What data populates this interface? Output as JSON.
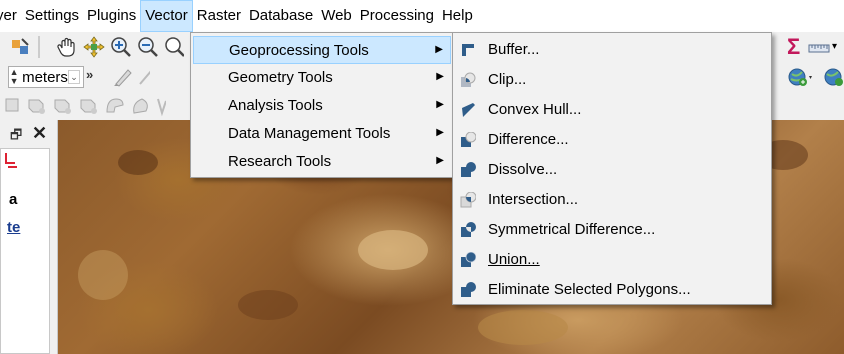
{
  "menubar": {
    "items": [
      {
        "label": "yer"
      },
      {
        "label": "Settings"
      },
      {
        "label": "Plugins"
      },
      {
        "label": "Vector",
        "active": true
      },
      {
        "label": "Raster"
      },
      {
        "label": "Database"
      },
      {
        "label": "Web"
      },
      {
        "label": "Processing"
      },
      {
        "label": "Help"
      }
    ]
  },
  "toolbar2": {
    "unit_value": "meters",
    "overflow": "»"
  },
  "toolbar1": {
    "sigma": "Σ"
  },
  "layers_panel": {
    "float": "🗗",
    "close": "✕",
    "item_a": "a",
    "item_te": "te"
  },
  "vector_menu": {
    "items": [
      {
        "label": "Geoprocessing Tools",
        "highlighted": true
      },
      {
        "label": "Geometry Tools"
      },
      {
        "label": "Analysis Tools"
      },
      {
        "label": "Data Management Tools"
      },
      {
        "label": "Research Tools"
      }
    ],
    "arrow": "▶"
  },
  "geoprocessing_menu": {
    "items": [
      {
        "label": "Buffer...",
        "icon": "buffer-icon"
      },
      {
        "label": "Clip...",
        "icon": "clip-icon"
      },
      {
        "label": "Convex Hull...",
        "icon": "convex-hull-icon"
      },
      {
        "label": "Difference...",
        "icon": "difference-icon"
      },
      {
        "label": "Dissolve...",
        "icon": "dissolve-icon"
      },
      {
        "label": "Intersection...",
        "icon": "intersection-icon"
      },
      {
        "label": "Symmetrical Difference...",
        "icon": "symmetrical-difference-icon"
      },
      {
        "label": "Union...",
        "icon": "union-icon"
      },
      {
        "label": "Eliminate Selected Polygons...",
        "icon": "eliminate-selected-polygons-icon"
      }
    ]
  },
  "colors": {
    "menu_highlight": "#cce8ff",
    "menu_highlight_border": "#99d1ff",
    "icon_blue": "#2f5d8a",
    "canvas_brown": "#8b5a2b"
  }
}
